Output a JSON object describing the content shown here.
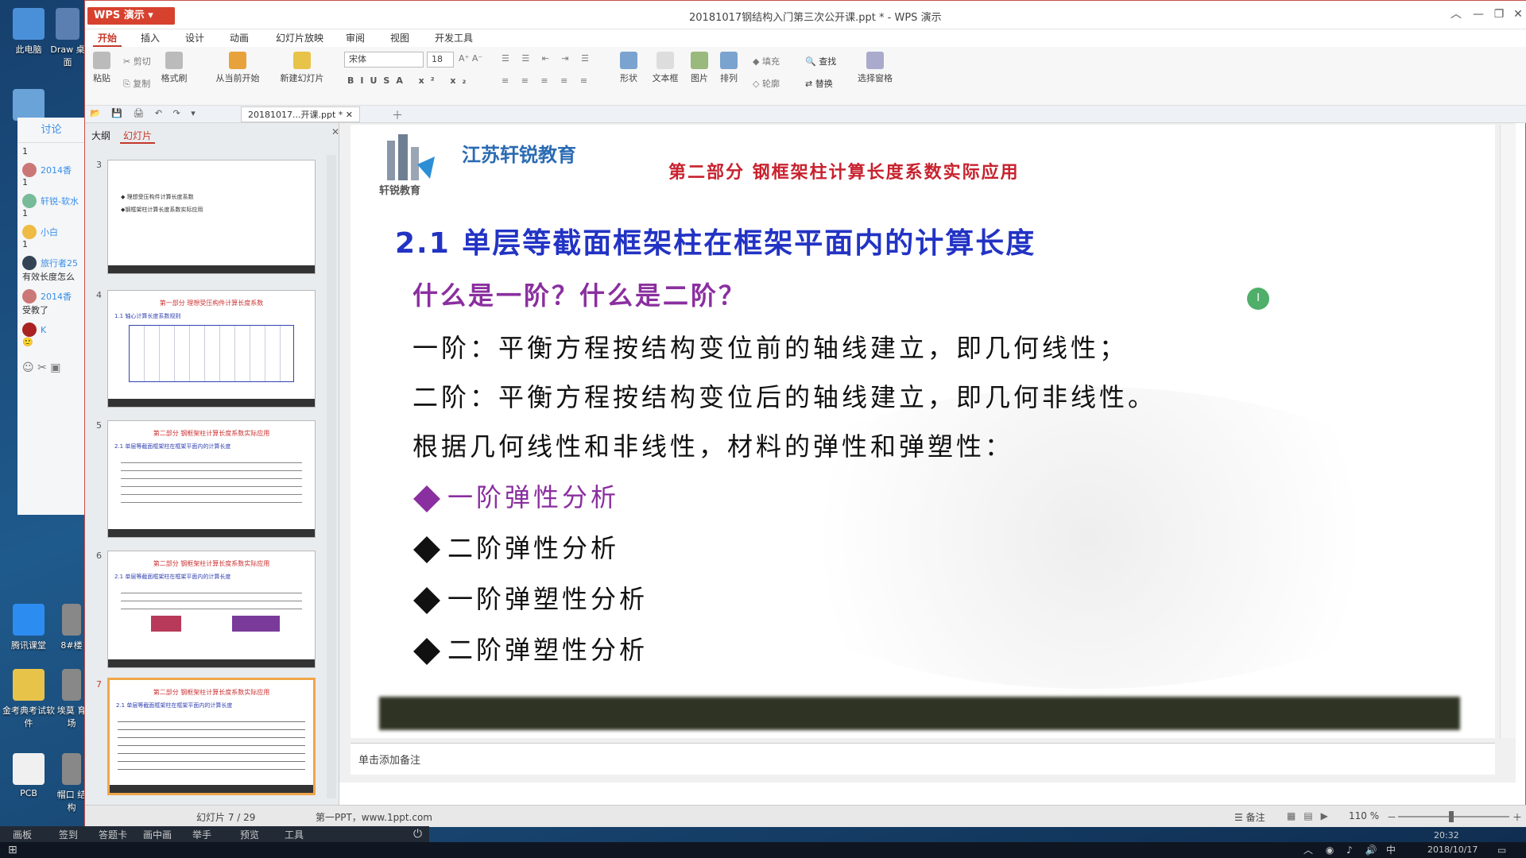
{
  "desktop": {
    "icons": [
      {
        "label": "此电脑"
      },
      {
        "label": "Draw 桌面"
      },
      {
        "label": "腾讯课堂"
      },
      {
        "label": "8#楼"
      },
      {
        "label": "金考典考试软件"
      },
      {
        "label": "埃莫 育场"
      },
      {
        "label": "PCB"
      },
      {
        "label": "帽口 结构"
      }
    ]
  },
  "chat": {
    "tab": "讨论",
    "messages": [
      {
        "num": "1"
      },
      {
        "name": "2014香",
        "num": "1"
      },
      {
        "name": "轩锐-软水",
        "num": "1"
      },
      {
        "name": "小白",
        "num": "1"
      },
      {
        "name": "旅行者25",
        "text": "有效长度怎么"
      },
      {
        "name": "2014香",
        "text": "受教了"
      },
      {
        "name": "K",
        "text": "🙂"
      }
    ]
  },
  "titlebar": {
    "app": "WPS 演示",
    "doc_title": "20181017钢结构入门第三次公开课.ppt * - WPS 演示"
  },
  "menu": [
    "开始",
    "插入",
    "设计",
    "动画",
    "幻灯片放映",
    "审阅",
    "视图",
    "开发工具"
  ],
  "ribbon": {
    "paste": "粘贴",
    "cut": "剪切",
    "copy": "复制",
    "format_painter": "格式刷",
    "from_current": "从当前开始",
    "new_slide": "新建幻灯片",
    "font_name": "宋体",
    "font_size": "18",
    "shape": "形状",
    "textbox": "文本框",
    "picture": "图片",
    "arrange": "排列",
    "fill": "填充",
    "outline": "轮廓",
    "find": "查找",
    "replace": "替换",
    "selection_pane": "选择窗格"
  },
  "doc_tab": "20181017...开课.ppt *",
  "pane": {
    "tabs": [
      "大纲",
      "幻灯片"
    ],
    "slides": [
      {
        "num": "3",
        "lines": [
          "◆ 理想受压构件计算长度系数",
          "◆钢框架柱计算长度系数实际应用"
        ]
      },
      {
        "num": "4",
        "title": "第一部分 理想受压构件计算长度系数",
        "sub": "1.1 轴心计算长度系数规则"
      },
      {
        "num": "5",
        "title": "第二部分 钢框架柱计算长度系数实际应用",
        "sub": "2.1 单层等截面框架柱在框架平面内的计算长度"
      },
      {
        "num": "6",
        "title": "第二部分 钢框架柱计算长度系数实际应用",
        "sub": "2.1 单层等截面框架柱在框架平面内的计算长度"
      },
      {
        "num": "7",
        "title": "第二部分 钢框架柱计算长度系数实际应用",
        "sub": "2.1 单层等截面框架柱在框架平面内的计算长度"
      }
    ]
  },
  "slide": {
    "brand": "江苏轩锐教育",
    "logo_text": "轩锐教育",
    "section": "第二部分 钢框架柱计算长度系数实际应用",
    "heading": "2.1  单层等截面框架柱在框架平面内的计算长度",
    "question": "什么是一阶？什么是二阶？",
    "line1": "一阶：平衡方程按结构变位前的轴线建立，即几何线性；",
    "line2": "二阶：平衡方程按结构变位后的轴线建立，即几何非线性。",
    "line3": "根据几何线性和非线性，材料的弹性和弹塑性：",
    "bullets": [
      "一阶弹性分析",
      "二阶弹性分析",
      "一阶弹塑性分析",
      "二阶弹塑性分析"
    ],
    "bullet_colors": [
      "#8a2f9f",
      "#111111",
      "#111111",
      "#111111"
    ],
    "cursor_glyph": "I"
  },
  "notes": "单击添加备注",
  "status": {
    "slide_info": "幻灯片 7 / 29",
    "theme": "第一PPT，www.1ppt.com",
    "notes_btn": "备注",
    "zoom": "110 %"
  },
  "bottom_tools": [
    "画板",
    "签到",
    "答题卡",
    "画中画",
    "举手",
    "预览",
    "工具"
  ],
  "taskbar": {
    "time": "20:32",
    "date": "2018/10/17",
    "ime": "中"
  }
}
